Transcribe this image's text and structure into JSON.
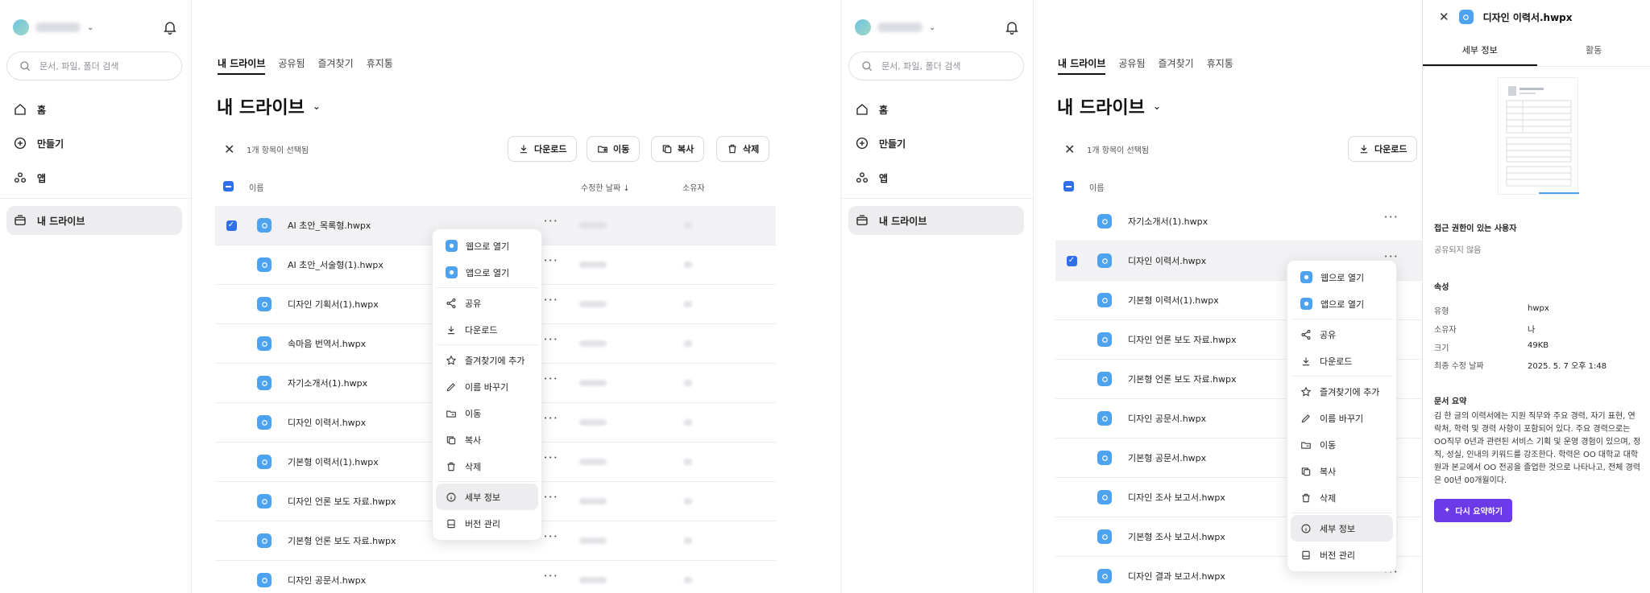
{
  "sidebar": {
    "search_placeholder": "문서, 파일, 폴더 검색",
    "nav": {
      "home": "홈",
      "create": "만들기",
      "apps": "앱",
      "my_drive": "내 드라이브"
    }
  },
  "tabs": [
    "내 드라이브",
    "공유됨",
    "즐겨찾기",
    "휴지통"
  ],
  "drive_title": "내 드라이브",
  "selection_text": "1개 항목이 선택됨",
  "actions": {
    "download": "다운로드",
    "move": "이동",
    "copy": "복사",
    "delete": "삭제"
  },
  "columns": {
    "name": "이름",
    "modified": "수정한 날짜",
    "owner": "소유자"
  },
  "left_files": [
    "AI 초안_목록형.hwpx",
    "AI 초안_서술형(1).hwpx",
    "디자인 기획서(1).hwpx",
    "속마음 번역서.hwpx",
    "자기소개서(1).hwpx",
    "디자인 이력서.hwpx",
    "기본형 이력서(1).hwpx",
    "디자인 언론 보도 자료.hwpx",
    "기본형 언론 보도 자료.hwpx",
    "디자인 공문서.hwpx"
  ],
  "right_files": [
    "자기소개서(1).hwpx",
    "디자인 이력서.hwpx",
    "기본형 이력서(1).hwpx",
    "디자인 언론 보도 자료.hwpx",
    "기본형 언론 보도 자료.hwpx",
    "디자인 공문서.hwpx",
    "기본형 공문서.hwpx",
    "디자인 조사 보고서.hwpx",
    "기본형 조사 보고서.hwpx",
    "디자인 결과 보고서.hwpx"
  ],
  "context_menu": {
    "open_web": "웹으로 열기",
    "open_app": "앱으로 열기",
    "share": "공유",
    "download": "다운로드",
    "favorite": "즐겨찾기에 추가",
    "rename": "이름 바꾸기",
    "move": "이동",
    "copy": "복사",
    "delete": "삭제",
    "details": "세부 정보",
    "versions": "버전 관리"
  },
  "details": {
    "title": "디자인 이력서.hwpx",
    "tab_info": "세부 정보",
    "tab_activity": "활동",
    "access_header": "접근 권한이 있는 사용자",
    "access_value": "공유되지 않음",
    "props_header": "속성",
    "props": [
      {
        "k": "유형",
        "v": "hwpx"
      },
      {
        "k": "소유자",
        "v": "나"
      },
      {
        "k": "크기",
        "v": "49KB"
      },
      {
        "k": "최종 수정 날짜",
        "v": "2025. 5. 7 오후 1:48"
      }
    ],
    "summary_header": "문서 요약",
    "summary_text": "김 한 글의 이력서에는 지원 직무와 주요 경력, 자기 표현, 연락처, 학력 및 경력 사항이 포함되어 있다. 주요 경력으로는 OO직무 0년과 관련된 서비스 기획 및 운영 경험이 있으며, 정직, 성실, 인내의 키워드를 강조한다. 학력은 OO 대학교 대학원과 본교에서 OO 전공을 졸업한 것으로 나타나고, 전체 경력은 00년 00개월이다.",
    "resummarize": "다시 요약하기"
  },
  "colors": {
    "accent": "#2f6fe8",
    "app_icon": "#4ea3f1",
    "resummarize": "#6c3ae6"
  }
}
